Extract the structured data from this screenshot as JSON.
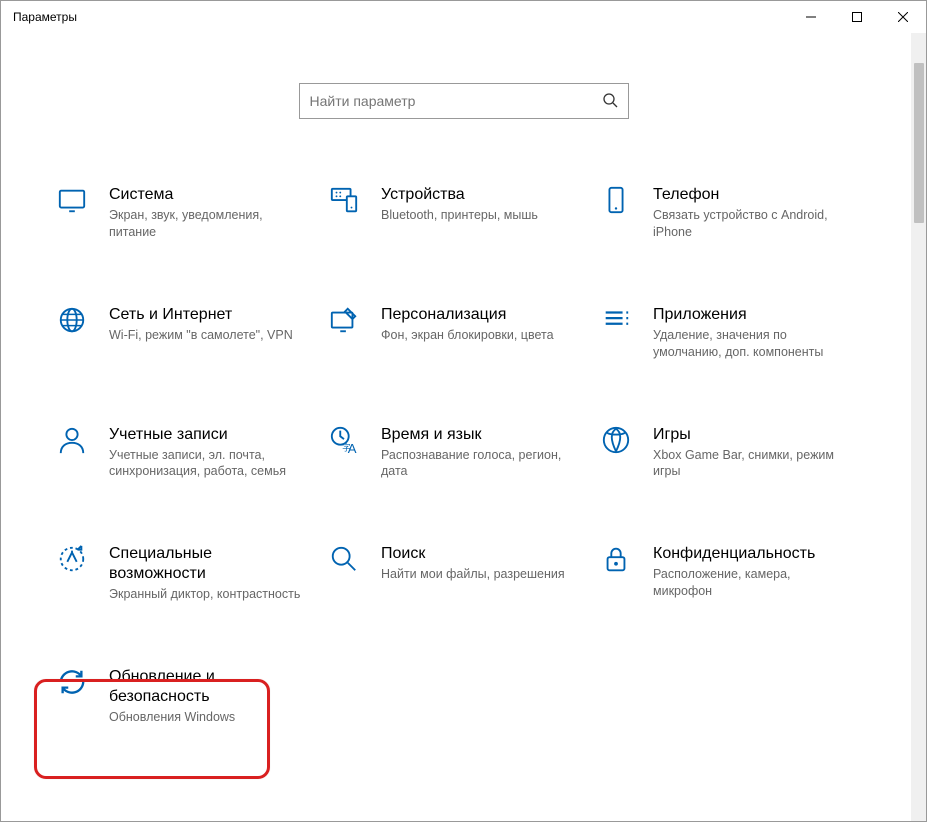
{
  "window": {
    "title": "Параметры"
  },
  "search": {
    "placeholder": "Найти параметр"
  },
  "tiles": {
    "system": {
      "title": "Система",
      "sub": "Экран, звук, уведомления, питание"
    },
    "devices": {
      "title": "Устройства",
      "sub": "Bluetooth, принтеры, мышь"
    },
    "phone": {
      "title": "Телефон",
      "sub": "Связать устройство с Android, iPhone"
    },
    "network": {
      "title": "Сеть и Интернет",
      "sub": "Wi-Fi, режим \"в самолете\", VPN"
    },
    "personalization": {
      "title": "Персонализация",
      "sub": "Фон, экран блокировки, цвета"
    },
    "apps": {
      "title": "Приложения",
      "sub": "Удаление, значения по умолчанию, доп. компоненты"
    },
    "accounts": {
      "title": "Учетные записи",
      "sub": "Учетные записи, эл. почта, синхронизация, работа, семья"
    },
    "time": {
      "title": "Время и язык",
      "sub": "Распознавание голоса, регион, дата"
    },
    "gaming": {
      "title": "Игры",
      "sub": "Xbox Game Bar, снимки, режим игры"
    },
    "ease": {
      "title": "Специальные возможности",
      "sub": "Экранный диктор, контрастность"
    },
    "searchTile": {
      "title": "Поиск",
      "sub": "Найти мои файлы, разрешения"
    },
    "privacy": {
      "title": "Конфиденциальность",
      "sub": "Расположение, камера, микрофон"
    },
    "update": {
      "title": "Обновление и безопасность",
      "sub": "Обновления Windows"
    }
  }
}
